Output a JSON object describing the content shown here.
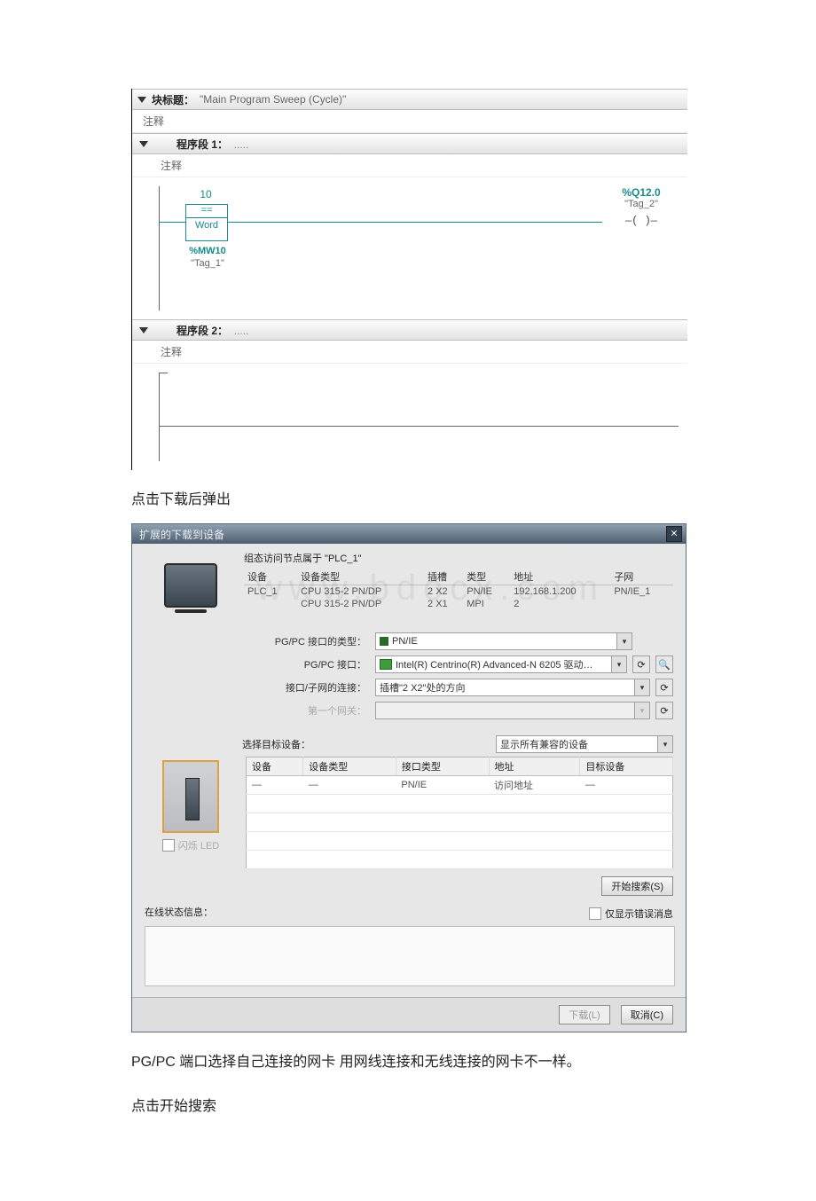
{
  "ladder": {
    "block_label": "块标题：",
    "block_title": "\"Main Program Sweep (Cycle)\"",
    "comment": "注释",
    "net1": {
      "label": "程序段 1：",
      "dots": ".....",
      "comment": "注释",
      "compare_top": "10",
      "compare_eq": "==",
      "compare_type": "Word",
      "mw": "%MW10",
      "tag1": "\"Tag_1\"",
      "out_addr": "%Q12.0",
      "out_name": "\"Tag_2\"",
      "coil": "—(    )—"
    },
    "net2": {
      "label": "程序段 2：",
      "dots": ".....",
      "comment": "注释"
    }
  },
  "para1": "点击下载后弹出",
  "dialog": {
    "title": "扩展的下载到设备",
    "caption": "组态访问节点属于 \"PLC_1\"",
    "head": {
      "cols": [
        "设备",
        "设备类型",
        "插槽",
        "类型",
        "地址",
        "子网"
      ],
      "rows": [
        [
          "PLC_1",
          "CPU 315-2 PN/DP",
          "2 X2",
          "PN/IE",
          "192.168.1.200",
          "PN/IE_1"
        ],
        [
          "",
          "CPU 315-2 PN/DP",
          "2 X1",
          "MPI",
          "2",
          ""
        ]
      ]
    },
    "pgpc_type_label": "PG/PC 接口的类型：",
    "pgpc_type_value": "PN/IE",
    "pgpc_if_label": "PG/PC 接口：",
    "pgpc_if_value": "Intel(R) Centrino(R) Advanced-N 6205 驱动…",
    "conn_label": "接口/子网的连接：",
    "conn_value": "插槽\"2 X2\"处的方向",
    "gateway_label": "第一个网关：",
    "gateway_value": "",
    "select_target": "选择目标设备：",
    "filter_value": "显示所有兼容的设备",
    "dev_cols": [
      "设备",
      "设备类型",
      "接口类型",
      "地址",
      "目标设备"
    ],
    "dev_row": [
      "—",
      "—",
      "PN/IE",
      "访问地址",
      "—"
    ],
    "led_label": "闪烁 LED",
    "search_btn": "开始搜索(S)",
    "status_label": "在线状态信息：",
    "err_only": "仅显示错误消息",
    "download_btn": "下载(L)",
    "cancel_btn": "取消(C)"
  },
  "para2": "PG/PC 端口选择自己连接的网卡 用网线连接和无线连接的网卡不一样。",
  "para3": "点击开始搜索"
}
